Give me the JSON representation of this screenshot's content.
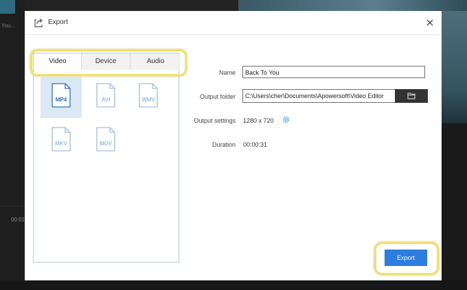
{
  "background": {
    "left_text": "You...",
    "timecode": "00:01"
  },
  "dialog": {
    "title": "Export",
    "icons": {
      "title": "export-share-icon",
      "close": "close-icon"
    }
  },
  "tabs": [
    {
      "label": "Video",
      "active": true
    },
    {
      "label": "Device",
      "active": false
    },
    {
      "label": "Audio",
      "active": false
    }
  ],
  "formats": [
    {
      "label": "MP4",
      "selected": true
    },
    {
      "label": "AVI",
      "selected": false
    },
    {
      "label": "WMV",
      "selected": false
    },
    {
      "label": "MKV",
      "selected": false
    },
    {
      "label": "MOV",
      "selected": false
    }
  ],
  "form": {
    "name_label": "Name",
    "name_value": "Back To You",
    "folder_label": "Output folder",
    "folder_value": "C:\\Users\\cher\\Documents\\Apowersoft\\Video Editor",
    "folder_icon": "folder-open-icon",
    "settings_label": "Output settings",
    "settings_value": "1280 x 720",
    "settings_icon": "gear-icon",
    "duration_label": "Duration",
    "duration_value": "00:00:31"
  },
  "export_button": {
    "label": "Export"
  },
  "colors": {
    "accent": "#2b7de1",
    "highlight": "#f1e06a",
    "selected_bg": "#dbe9f7",
    "format_icon": "#9cc0e3",
    "format_icon_selected": "#2e71c8"
  }
}
